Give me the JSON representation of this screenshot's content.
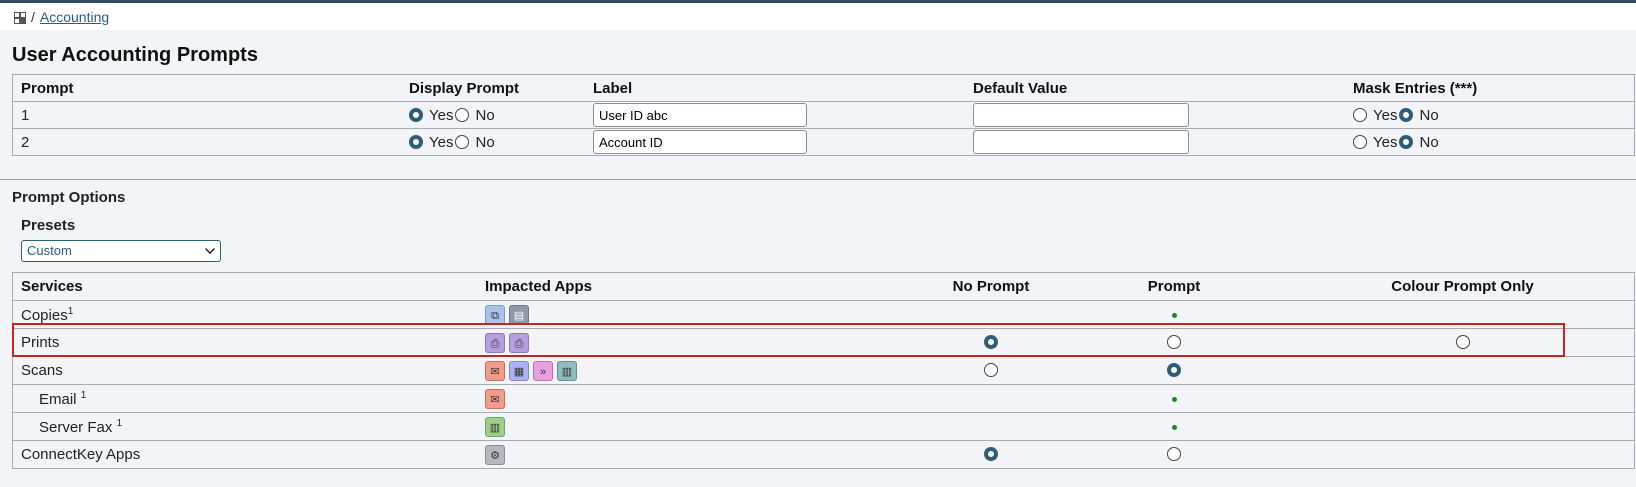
{
  "breadcrumb": {
    "section": "Accounting"
  },
  "page_title": "User Accounting Prompts",
  "prompts_table": {
    "headers": [
      "Prompt",
      "Display Prompt",
      "Label",
      "Default Value",
      "Mask Entries (***)"
    ],
    "yes_label": "Yes",
    "no_label": "No",
    "rows": [
      {
        "prompt": "1",
        "display": "Yes",
        "label_value": "User ID abc",
        "default_value": "",
        "mask": "No"
      },
      {
        "prompt": "2",
        "display": "Yes",
        "label_value": "Account ID",
        "default_value": "",
        "mask": "No"
      }
    ]
  },
  "prompt_options": {
    "title": "Prompt Options",
    "presets_label": "Presets",
    "presets_selected": "Custom"
  },
  "services_table": {
    "headers": [
      "Services",
      "Impacted Apps",
      "No Prompt",
      "Prompt",
      "Colour Prompt Only"
    ],
    "rows": [
      {
        "name": "Copies",
        "sup": "1",
        "icons": [
          "copy-icon",
          "id-card-copy-icon"
        ],
        "no_prompt": "",
        "prompt": "dot",
        "colour": ""
      },
      {
        "name": "Prints",
        "sup": "",
        "icons": [
          "printer-icon",
          "printer-icon"
        ],
        "no_prompt": "selected",
        "prompt": "unselected",
        "colour": "unselected"
      },
      {
        "name": "Scans",
        "sup": "",
        "icons": [
          "email-icon",
          "scan-icon",
          "workflow-icon",
          "server-fax-icon"
        ],
        "no_prompt": "unselected",
        "prompt": "selected",
        "colour": ""
      },
      {
        "name": "Email ",
        "sup": "1",
        "icons": [
          "email-icon"
        ],
        "no_prompt": "",
        "prompt": "dot",
        "colour": ""
      },
      {
        "name": "Server Fax ",
        "sup": "1",
        "icons": [
          "server-fax-icon"
        ],
        "no_prompt": "",
        "prompt": "dot",
        "colour": ""
      },
      {
        "name": "ConnectKey Apps",
        "sup": "",
        "icons": [
          "gear-icon"
        ],
        "no_prompt": "selected",
        "prompt": "unselected",
        "colour": ""
      }
    ]
  },
  "colors": {
    "accent": "#2e5d7a",
    "highlight_border": "#cc2222",
    "dot_green": "#1e8a1e"
  }
}
